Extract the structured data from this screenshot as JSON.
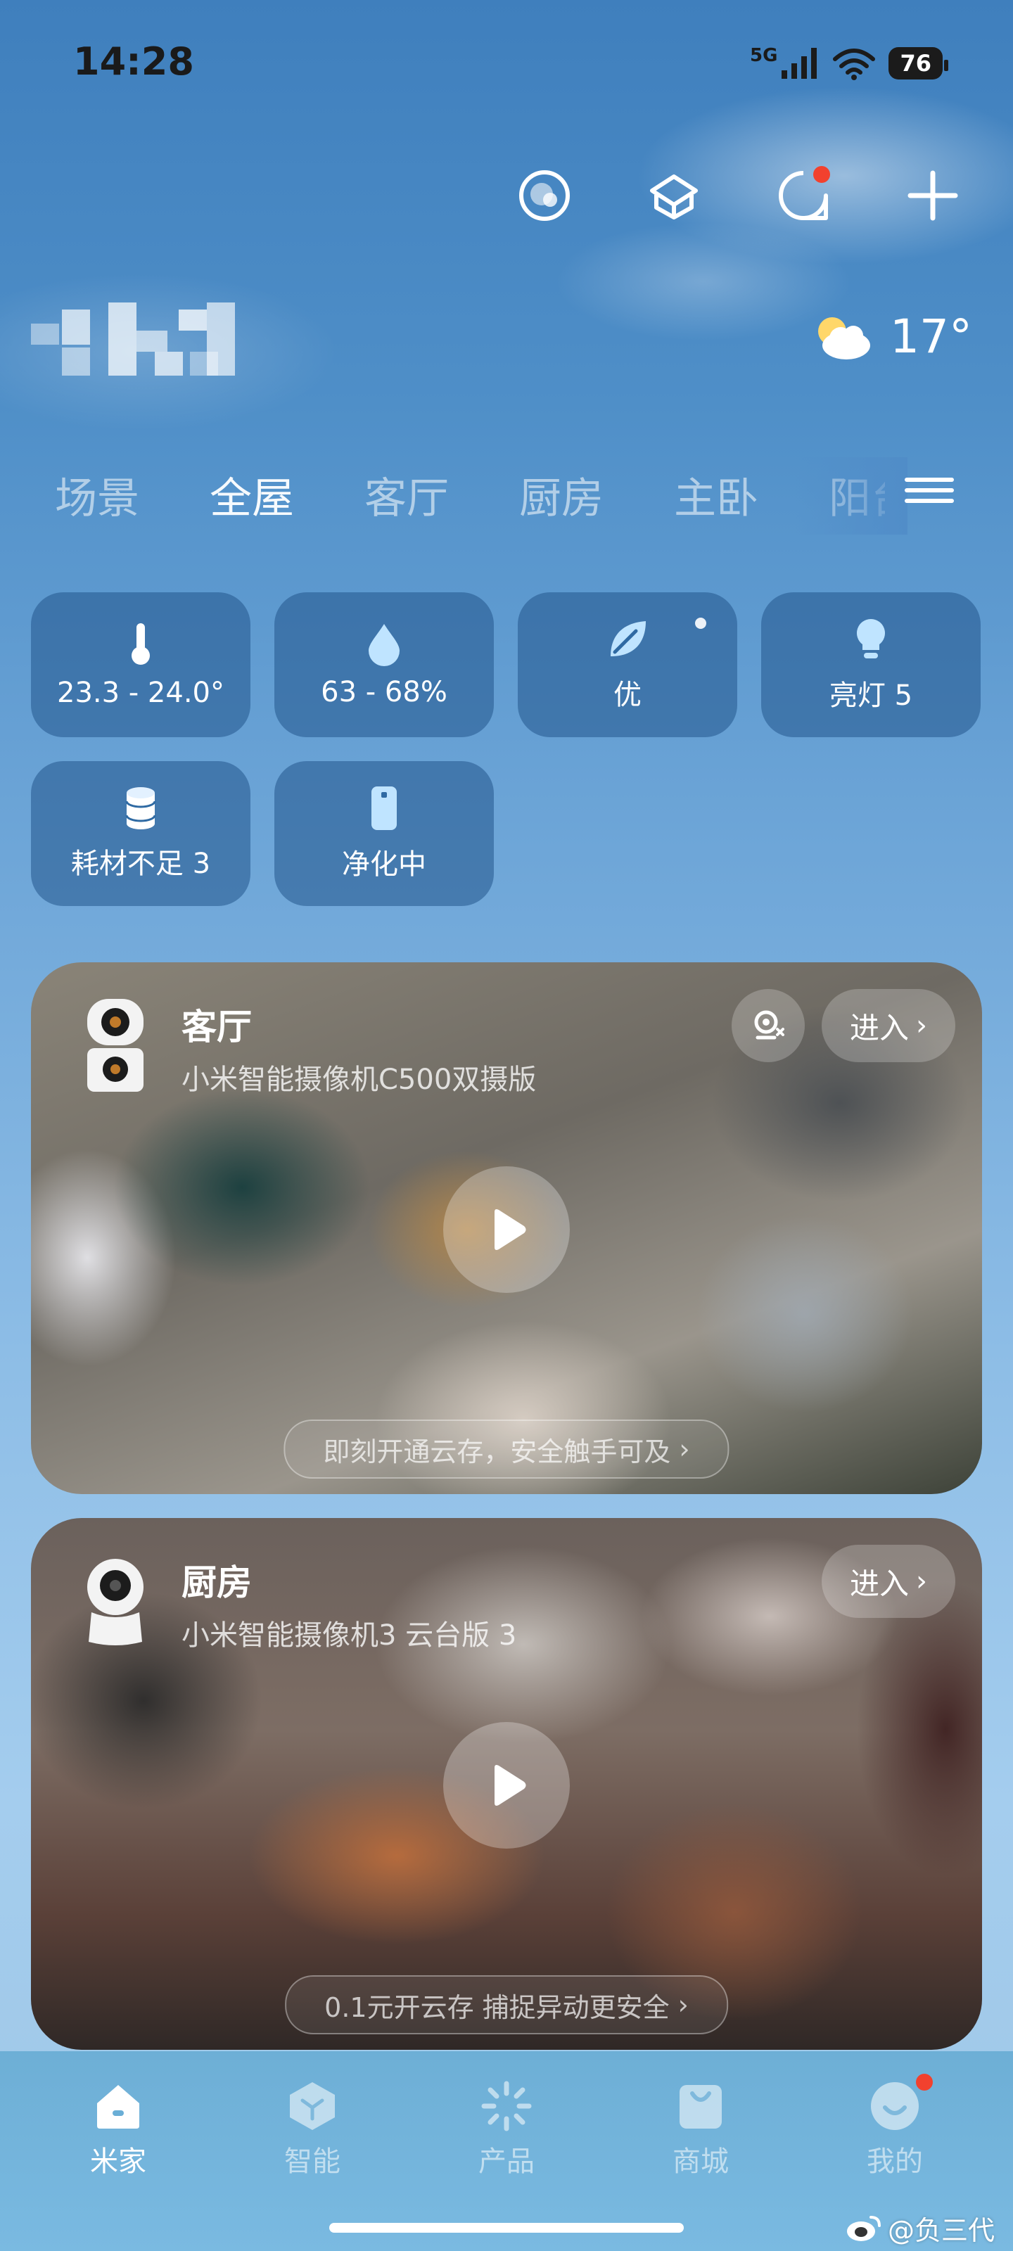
{
  "status_bar": {
    "time": "14:28",
    "network": "5G",
    "battery": "76"
  },
  "header": {
    "weather": {
      "icon": "partly-cloudy-icon",
      "temperature": "17°"
    }
  },
  "room_tabs": [
    {
      "label": "场景"
    },
    {
      "label": "全屋",
      "active": true
    },
    {
      "label": "客厅"
    },
    {
      "label": "厨房"
    },
    {
      "label": "主卧"
    },
    {
      "label": "阳台"
    }
  ],
  "stats": [
    {
      "icon": "thermometer-icon",
      "label": "23.3 - 24.0°"
    },
    {
      "icon": "droplet-icon",
      "label": "63 - 68%"
    },
    {
      "icon": "leaf-icon",
      "label": "优"
    },
    {
      "icon": "bulb-icon",
      "label": "亮灯 5"
    },
    {
      "icon": "cylinder-icon",
      "label": "耗材不足 3"
    },
    {
      "icon": "purifier-icon",
      "label": "净化中"
    }
  ],
  "cameras": [
    {
      "room": "客厅",
      "model": "小米智能摄像机C500双摄版",
      "enter_label": "进入",
      "promo": "即刻开通云存，安全触手可及"
    },
    {
      "room": "厨房",
      "model": "小米智能摄像机3 云台版 3",
      "enter_label": "进入",
      "promo": "0.1元开云存 捕捉异动更安全"
    }
  ],
  "bottom_nav": [
    {
      "label": "米家",
      "icon": "home-icon",
      "active": true
    },
    {
      "label": "智能",
      "icon": "smart-cube-icon"
    },
    {
      "label": "产品",
      "icon": "product-sparkle-icon"
    },
    {
      "label": "商城",
      "icon": "shop-bag-icon"
    },
    {
      "label": "我的",
      "icon": "profile-smile-icon"
    }
  ],
  "watermark": "@负三代",
  "colors": {
    "notification_dot": "#f2412e",
    "tile_bg": "#2f6aa3"
  }
}
